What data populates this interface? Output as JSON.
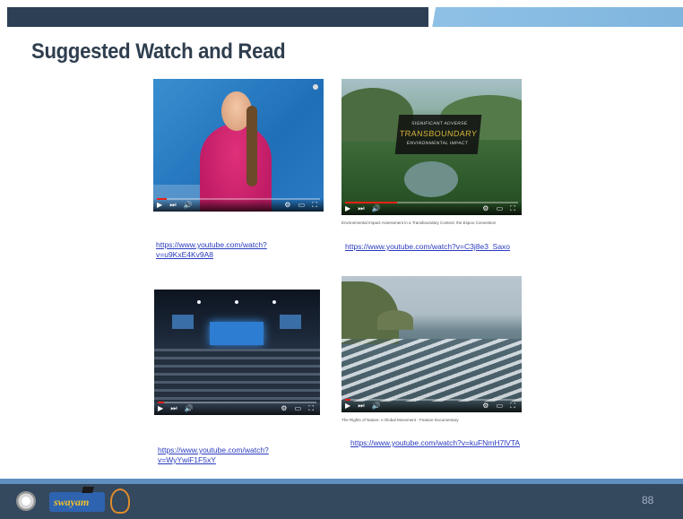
{
  "slide": {
    "title": "Suggested Watch and Read",
    "page_number": "88"
  },
  "videos": [
    {
      "link": "https://www.youtube.com/watch?v=u9KxE4Kv9A8",
      "caption": ""
    },
    {
      "link": "https://www.youtube.com/watch?v=C3j8e3_Saxo",
      "caption": "Environmental Impact Assessment in a Transboundary Context: the Espoo Convention",
      "overlay": {
        "line1": "SIGNIFICANT ADVERSE",
        "line2": "TRANSBOUNDARY",
        "line3": "ENVIRONMENTAL IMPACT"
      }
    },
    {
      "link": "https://www.youtube.com/watch?v=WyYwiF1F5xY",
      "caption": ""
    },
    {
      "link": "https://www.youtube.com/watch?v=kuFNmH7lVTA",
      "caption": "The Rights of Nature: A Global Movement - Feature Documentary"
    }
  ],
  "player": {
    "controls_left": "▶ ⏭ 🔊",
    "controls_right": "⚙ ▭ ⛶",
    "progress_accent": "#e62117"
  },
  "footer": {
    "logos": [
      "gear-emblem",
      "swayam",
      "nptel"
    ],
    "swayam_label": "swayam"
  },
  "colors": {
    "title": "#2f3e4e",
    "link": "#2a3bbf",
    "top_bar": "#2c3f55",
    "top_accent": "#8fc1e6",
    "footer": "#34485e"
  }
}
